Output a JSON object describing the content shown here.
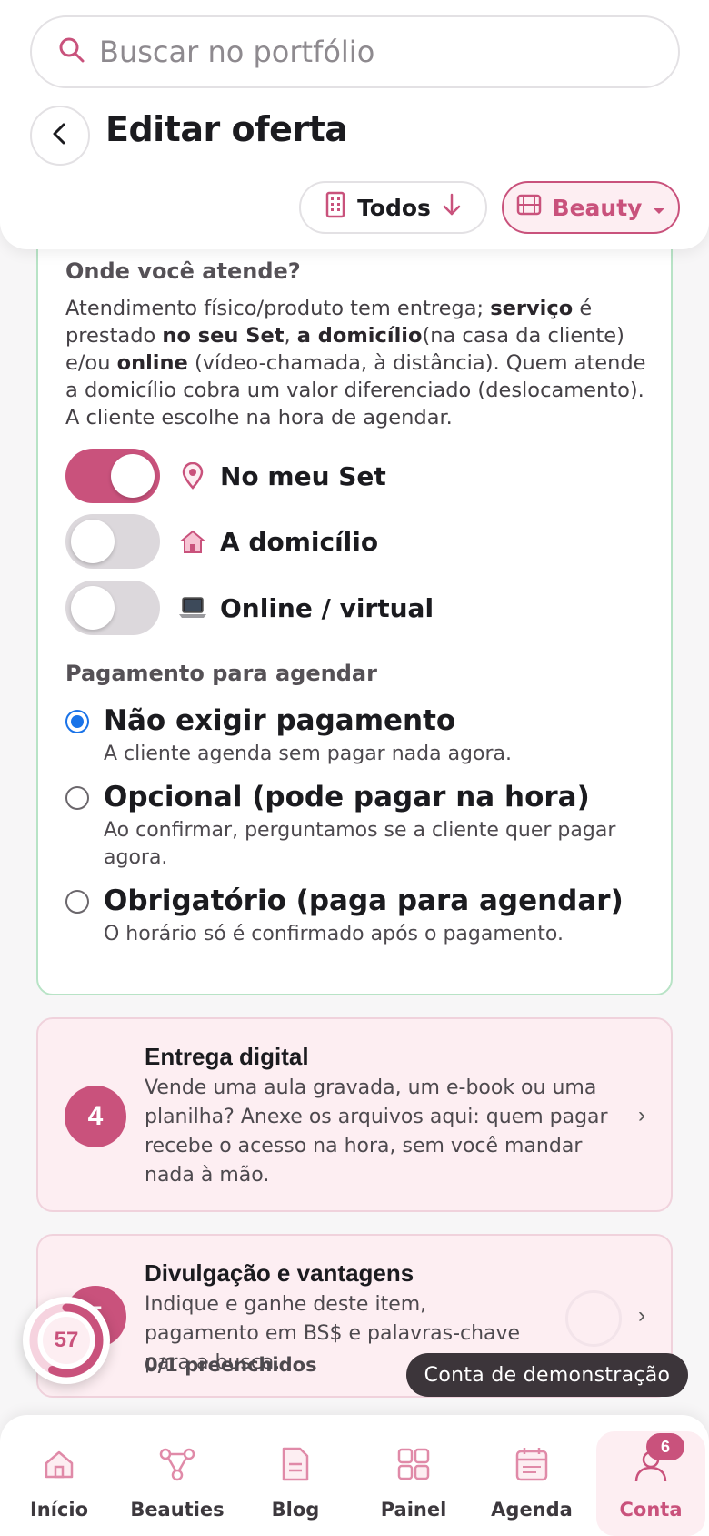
{
  "search": {
    "placeholder": "Buscar no portfólio"
  },
  "header": {
    "title": "Editar oferta"
  },
  "filters": {
    "todos_label": "Todos",
    "beauty_label": "Beauty"
  },
  "where": {
    "title": "Onde você atende?",
    "desc_1": "Atendimento físico/produto tem entrega; ",
    "desc_b1": "serviço",
    "desc_2": " é prestado ",
    "desc_b2": "no seu Set",
    "desc_3": ", ",
    "desc_b3": "a domicílio",
    "desc_4": "(na casa da cliente) e/ou ",
    "desc_b4": "online",
    "desc_5": " (vídeo-chamada, à distância). Quem atende a domicílio cobra um valor diferenciado (deslocamento). A cliente escolhe na hora de agendar.",
    "toggles": [
      {
        "label": "No meu Set",
        "on": true,
        "icon": "location-pin-icon"
      },
      {
        "label": "A domicílio",
        "on": false,
        "icon": "house-icon"
      },
      {
        "label": "Online / virtual",
        "on": false,
        "icon": "laptop-icon"
      }
    ]
  },
  "payment": {
    "title": "Pagamento para agendar",
    "options": [
      {
        "title": "Não exigir pagamento",
        "sub": "A cliente agenda sem pagar nada agora.",
        "selected": true
      },
      {
        "title": "Opcional (pode pagar na hora)",
        "sub": "Ao confirmar, perguntamos se a cliente quer pagar agora.",
        "selected": false
      },
      {
        "title": "Obrigatório (paga para agendar)",
        "sub": "O horário só é confirmado após o pagamento.",
        "selected": false
      }
    ]
  },
  "steps": [
    {
      "num": "4",
      "title": "Entrega digital",
      "desc": "Vende uma aula gravada, um e-book ou uma planilha? Anexe os arquivos aqui: quem pagar recebe o acesso na hora, sem você mandar nada à mão.",
      "chevron": "›"
    },
    {
      "num": "5",
      "title": "Divulgação e vantagens",
      "desc": "Indique e ganhe deste item, pagamento em BS$ e palavras-chave para a busca.",
      "meta": "0/1 preenchidos",
      "chevron": "›"
    }
  ],
  "score": {
    "value": "57",
    "progress": 0.57
  },
  "toast": {
    "text": "Conta de demonstração"
  },
  "nav": {
    "items": [
      {
        "label": "Início",
        "icon": "home-icon"
      },
      {
        "label": "Beauties",
        "icon": "network-icon"
      },
      {
        "label": "Blog",
        "icon": "document-icon"
      },
      {
        "label": "Painel",
        "icon": "dashboard-icon"
      },
      {
        "label": "Agenda",
        "icon": "calendar-icon"
      },
      {
        "label": "Conta",
        "icon": "user-icon",
        "active": true
      }
    ],
    "badge": "6"
  },
  "colors": {
    "accent": "#c9527c",
    "accent_light": "#fdeef2",
    "radio_selected": "#1a73e8",
    "card_border": "#b8e3c6"
  }
}
